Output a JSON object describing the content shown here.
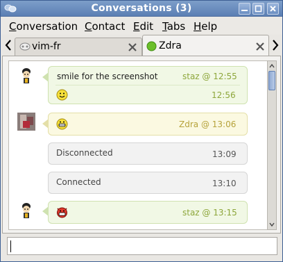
{
  "window": {
    "title": "Conversations (3)"
  },
  "menu": [
    "Conversation",
    "Contact",
    "Edit",
    "Tabs",
    "Help"
  ],
  "tabs": [
    {
      "label": "vim-fr"
    },
    {
      "label": "Zdra"
    }
  ],
  "messages": [
    {
      "text": "smile for the screenshot",
      "meta": "staz @ 12:55",
      "followup_time": "12:56"
    },
    {
      "meta": "Zdra @ 13:06"
    },
    {
      "text": "Disconnected",
      "time": "13:09"
    },
    {
      "text": "Connected",
      "time": "13:10"
    },
    {
      "meta": "staz @ 13:15"
    }
  ],
  "input": {
    "value": ""
  },
  "colors": {
    "titlebar": "#6a8ec2",
    "self_bubble": "#f1f8e5",
    "other_bubble": "#fbf9e1",
    "status_bubble": "#f2f2f2",
    "self_meta": "#8da63a"
  }
}
